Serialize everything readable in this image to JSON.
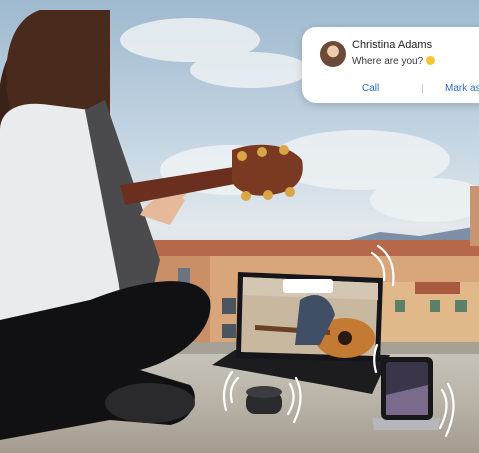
{
  "notification": {
    "contact_name": "Christina Adams",
    "message": "Where are you?",
    "emoji_icon": "smiley-emoji-icon",
    "actions": {
      "call_label": "Call",
      "mark_as_read_label": "Mark as"
    }
  },
  "icons": {
    "avatar": "contact-avatar",
    "sound_waves": "sound-wave-icon"
  },
  "colors": {
    "action_text": "#2a6fd1",
    "notification_bg": "#ffffff"
  }
}
